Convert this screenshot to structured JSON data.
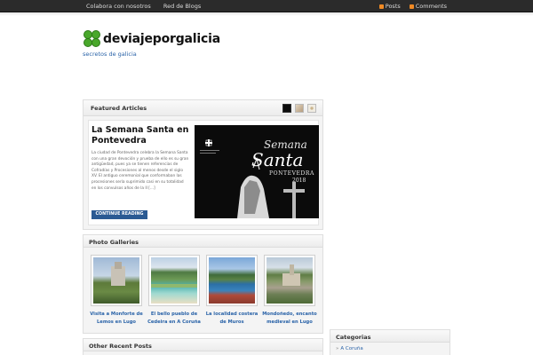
{
  "topbar": {
    "left_links": [
      "Colabora con nosotros",
      "Red de Blogs"
    ],
    "posts_label": "Posts",
    "comments_label": "Comments"
  },
  "site": {
    "title": "deviajeporgalicia",
    "tagline": "secretos de galicia",
    "logo_icon": "clover-icon"
  },
  "featured": {
    "header": "Featured Articles",
    "article": {
      "title": "La Semana Santa en Pontevedra",
      "excerpt": "La ciudad de Pontevedra celebra la Semana Santa con una gran devoción y prueba de ello es su gran antigüedad, pues ya se tienen referencias de Cofradías y Procesiones al menos desde el siglo XV. El antiguo ceremonial que conformaban las procesiones sería suprimido casi en su totalidad en los convulsos años de la II [...]",
      "button": "CONTINUE READING",
      "image": {
        "line1": "Semana",
        "line2": "Santa",
        "line3": "PONTEVEDRA",
        "year": "2018"
      }
    }
  },
  "galleries": {
    "header": "Photo Galleries",
    "items": [
      {
        "caption": "Visita a Monforte de Lemos en Lugo"
      },
      {
        "caption": "El bello pueblo de Cedeira en A Coruña"
      },
      {
        "caption": "La localidad costera de Muros"
      },
      {
        "caption": "Mondoñedo, encanto medieval en Lugo"
      }
    ]
  },
  "recent": {
    "header": "Other Recent Posts"
  },
  "categories": {
    "header": "Categorias",
    "items": [
      "A Coruña"
    ]
  },
  "colors": {
    "topbar": "#2b2b2b",
    "link": "#2a63a8",
    "button": "#2a5a93",
    "rss": "#f08a24"
  }
}
